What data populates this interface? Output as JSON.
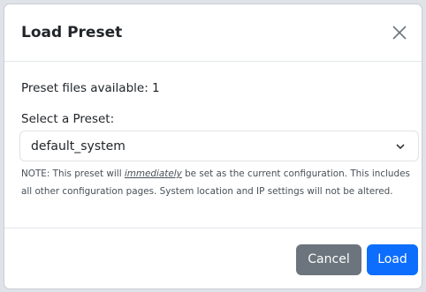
{
  "dialog": {
    "title": "Load Preset",
    "close_icon": "close-icon"
  },
  "body": {
    "files_available": "Preset files available: 1",
    "select_label": "Select a Preset:",
    "select_value": "default_system",
    "chevron_icon": "chevron-down-icon",
    "note_prefix": "NOTE: This preset will ",
    "note_emphasis": "immediately",
    "note_suffix": " be set as the current configuration. This includes all other configuration pages. System location and IP settings will not be altered."
  },
  "footer": {
    "cancel_label": "Cancel",
    "load_label": "Load"
  },
  "colors": {
    "primary": "#0d6efd",
    "secondary": "#6c757d"
  }
}
